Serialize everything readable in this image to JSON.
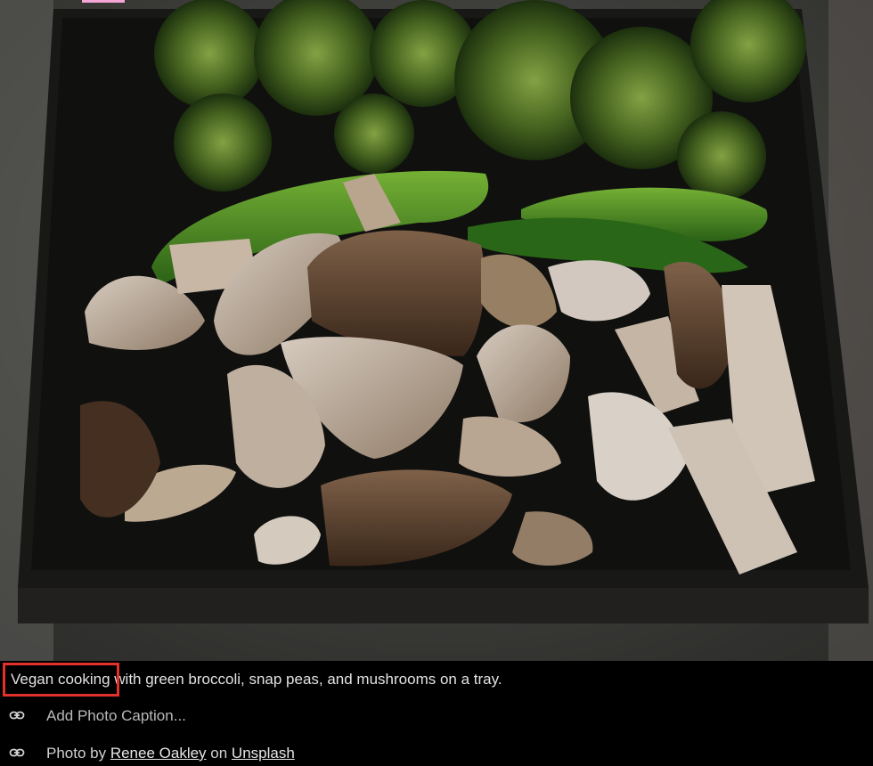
{
  "photo": {
    "icon": "photo",
    "description_subject": "tray of vegetables"
  },
  "caption": {
    "highlight_text": "Vegan cooking",
    "rest_text": " with green broccoli, snap peas, and mushrooms on a tray."
  },
  "add_caption": {
    "icon": "link-icon",
    "label": "Add Photo Caption..."
  },
  "credit": {
    "icon": "link-icon",
    "prefix": "Photo by ",
    "author": "Renee Oakley",
    "middle": " on ",
    "source": "Unsplash"
  },
  "colors": {
    "highlight_border": "#e0312a",
    "caption_background": "#000000"
  }
}
